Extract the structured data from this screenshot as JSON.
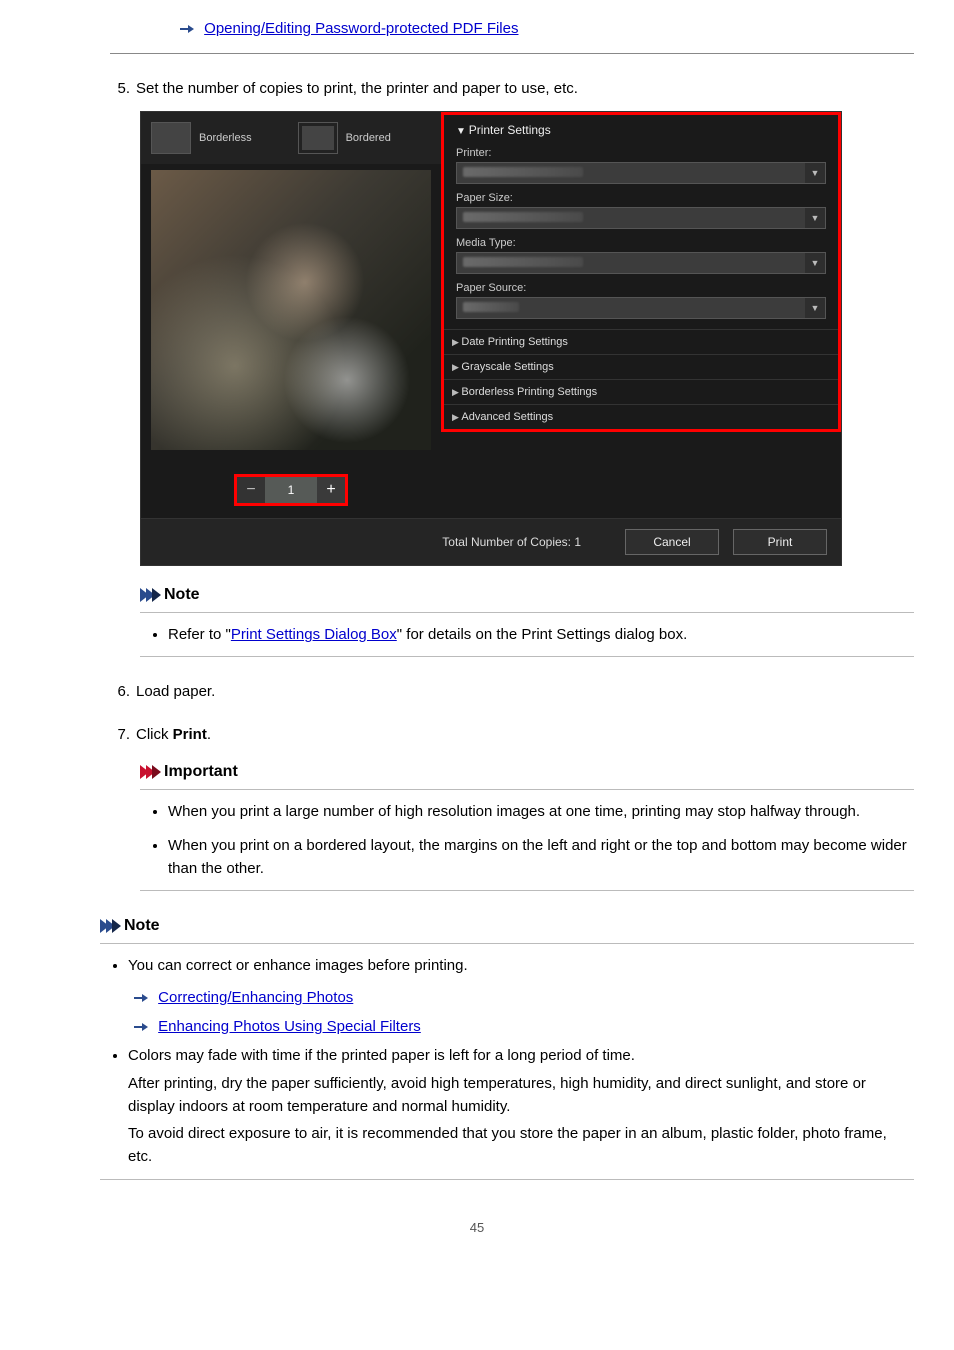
{
  "top_link": "Opening/Editing Password-protected PDF Files",
  "steps": {
    "s5": {
      "num": "5.",
      "text": "Set the number of copies to print, the printer and paper to use, etc."
    },
    "s6": {
      "num": "6.",
      "text": "Load paper."
    },
    "s7": {
      "num": "7.",
      "text_prefix": "Click ",
      "text_bold": "Print",
      "text_suffix": "."
    }
  },
  "shot": {
    "layout": {
      "borderless": "Borderless",
      "bordered": "Bordered"
    },
    "copies_value": "1",
    "printer_settings_head": "Printer Settings",
    "labels": {
      "printer": "Printer:",
      "paper_size": "Paper Size:",
      "media_type": "Media Type:",
      "paper_source": "Paper Source:"
    },
    "sections": {
      "date": "Date Printing Settings",
      "grayscale": "Grayscale Settings",
      "borderless": "Borderless Printing Settings",
      "advanced": "Advanced Settings"
    },
    "total_copies": "Total Number of Copies: 1",
    "cancel": "Cancel",
    "print": "Print"
  },
  "note1": {
    "head": "Note",
    "bullet_prefix": "Refer to \"",
    "bullet_link": "Print Settings Dialog Box",
    "bullet_suffix": "\" for details on the Print Settings dialog box."
  },
  "important": {
    "head": "Important",
    "b1": "When you print a large number of high resolution images at one time, printing may stop halfway through.",
    "b2": "When you print on a bordered layout, the margins on the left and right or the top and bottom may become wider than the other."
  },
  "note2": {
    "head": "Note",
    "b1": "You can correct or enhance images before printing.",
    "l1": "Correcting/Enhancing Photos",
    "l2": "Enhancing Photos Using Special Filters",
    "b2_line1": "Colors may fade with time if the printed paper is left for a long period of time.",
    "b2_line2": "After printing, dry the paper sufficiently, avoid high temperatures, high humidity, and direct sunlight, and store or display indoors at room temperature and normal humidity.",
    "b2_line3": "To avoid direct exposure to air, it is recommended that you store the paper in an album, plastic folder, photo frame, etc."
  },
  "page_number": "45"
}
